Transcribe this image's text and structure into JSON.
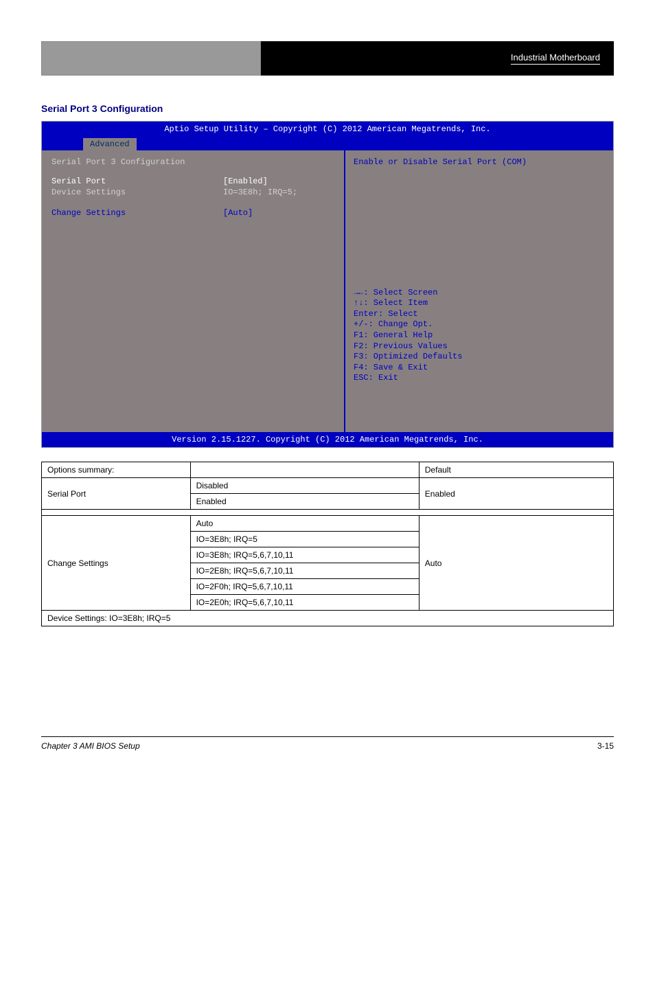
{
  "header": {
    "title": "Industrial Motherboard"
  },
  "section": {
    "title": "Serial Port 3 Configuration"
  },
  "bios": {
    "title": "Aptio Setup Utility – Copyright (C) 2012 American Megatrends, Inc.",
    "tab": "Advanced",
    "heading": "Serial Port 3 Configuration",
    "rows": [
      {
        "label": "Serial Port",
        "value": "[Enabled]",
        "hl": true
      },
      {
        "label": "Device Settings",
        "value": "IO=3E8h; IRQ=5;",
        "hl": false
      }
    ],
    "rows2": [
      {
        "label": "Change Settings",
        "value": "[Auto]",
        "hl": false
      }
    ],
    "help": "Enable or Disable Serial Port (COM)",
    "nav": [
      "→←: Select Screen",
      "↑↓: Select Item",
      "Enter: Select",
      "+/-: Change Opt.",
      "F1: General Help",
      "F2: Previous Values",
      "F3: Optimized Defaults",
      "F4: Save & Exit",
      "ESC: Exit"
    ],
    "footer": "Version 2.15.1227. Copyright (C) 2012 American Megatrends, Inc."
  },
  "table": {
    "rows": [
      {
        "name": "Serial Port",
        "opts": [
          "Disabled",
          "Enabled"
        ],
        "def": "Enabled",
        "note": ""
      },
      {
        "name": "Change Settings",
        "opts": [
          "Auto",
          "IO=3E8h; IRQ=5",
          "IO=3E8h; IRQ=5,6,7,10,11",
          "IO=2E8h; IRQ=5,6,7,10,11",
          "IO=2F0h; IRQ=5,6,7,10,11",
          "IO=2E0h; IRQ=5,6,7,10,11"
        ],
        "def": "Auto",
        "note": "Device Settings: IO=3E8h; IRQ=5"
      }
    ],
    "headers": [
      "Options summary:",
      "",
      "Default"
    ]
  },
  "footer": {
    "left": "Chapter 3 AMI BIOS Setup",
    "right": "3-15"
  }
}
